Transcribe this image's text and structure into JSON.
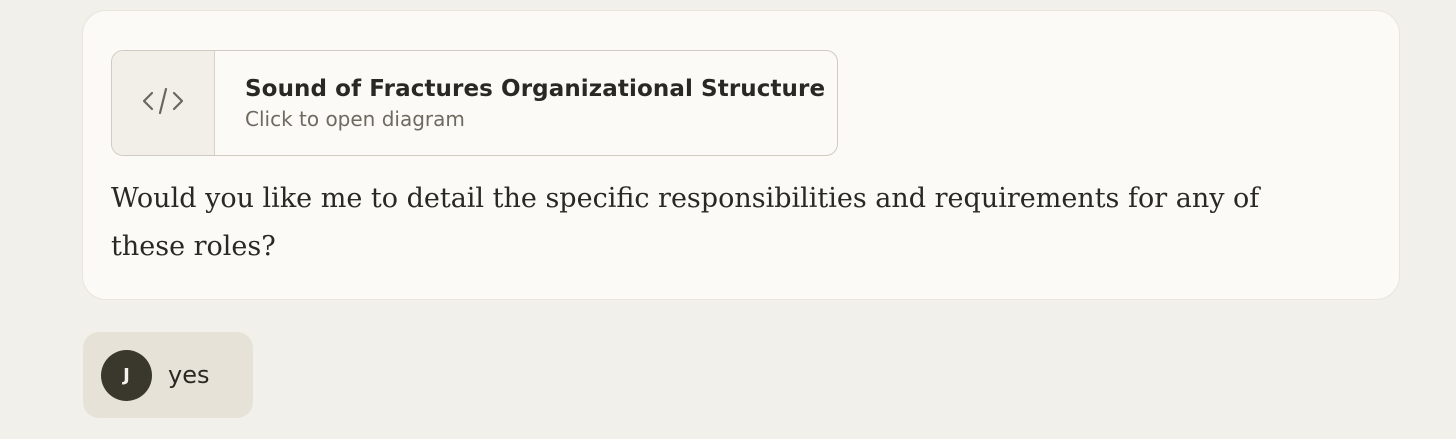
{
  "artifact": {
    "title": "Sound of Fractures Organizational Structure",
    "subtitle": "Click to open diagram",
    "icon": "code-icon"
  },
  "assistant_message": {
    "text": "Would you like me to detail the specific responsibilities and requirements for any of these roles?"
  },
  "user_message": {
    "avatar_initial": "J",
    "text": "yes"
  }
}
